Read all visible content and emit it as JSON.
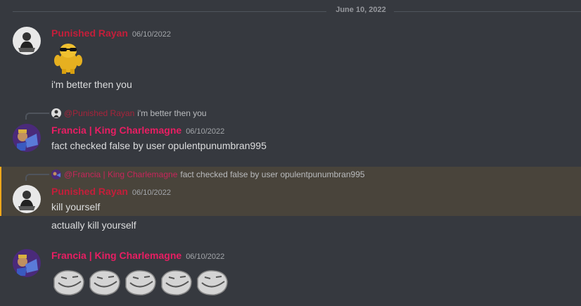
{
  "divider": {
    "date": "June 10, 2022"
  },
  "users": {
    "rayan": {
      "name": "Punished Rayan",
      "color": "#c41e3a"
    },
    "francia": {
      "name": "Francia | King Charlemagne",
      "color": "#e91e63"
    }
  },
  "messages": [
    {
      "author": "Punished Rayan",
      "timestamp": "06/10/2022",
      "emoji": "cool-doge-sunglasses-emoji",
      "lines": [
        "i'm better then you"
      ]
    },
    {
      "reply": {
        "mention": "@Punished Rayan",
        "text": "i'm better then you"
      },
      "author": "Francia | King Charlemagne",
      "timestamp": "06/10/2022",
      "lines": [
        "fact checked false by user opulentpunumbran995"
      ]
    },
    {
      "highlighted": true,
      "reply": {
        "mention": "@Francia | King Charlemagne",
        "text": "fact checked false by user opulentpunumbran995"
      },
      "author": "Punished Rayan",
      "timestamp": "06/10/2022",
      "lines": [
        "kill yourself",
        "actually kill yourself"
      ]
    },
    {
      "author": "Francia | King Charlemagne",
      "timestamp": "06/10/2022",
      "emojis": [
        "troll-face-emoji",
        "troll-face-emoji",
        "troll-face-emoji",
        "troll-face-emoji",
        "troll-face-emoji"
      ]
    }
  ]
}
